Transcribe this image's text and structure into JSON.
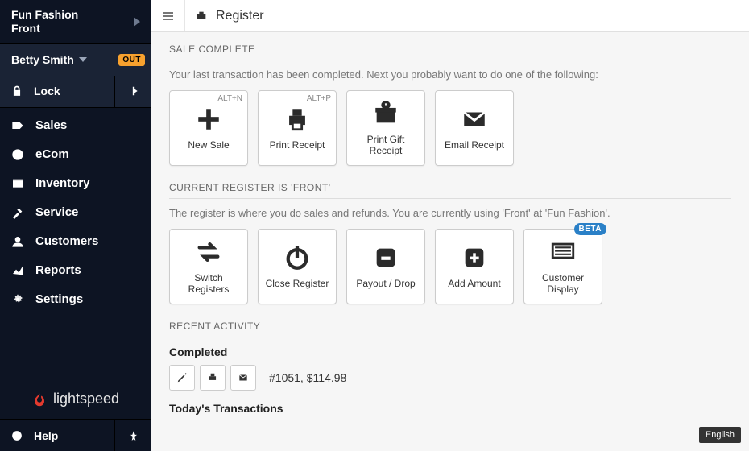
{
  "shop": {
    "name": "Fun Fashion\nFront"
  },
  "user": {
    "name": "Betty Smith",
    "badge": "OUT"
  },
  "lock_label": "Lock",
  "nav": [
    "Sales",
    "eCom",
    "Inventory",
    "Service",
    "Customers",
    "Reports",
    "Settings"
  ],
  "brand": "lightspeed",
  "help_label": "Help",
  "topbar": {
    "title": "Register"
  },
  "sale_complete": {
    "heading": "SALE COMPLETE",
    "subtext": "Your last transaction has been completed. Next you probably want to do one of the following:",
    "tiles": [
      {
        "label": "New Sale",
        "shortcut": "ALT+N"
      },
      {
        "label": "Print Receipt",
        "shortcut": "ALT+P"
      },
      {
        "label": "Print Gift Receipt",
        "shortcut": ""
      },
      {
        "label": "Email Receipt",
        "shortcut": ""
      }
    ]
  },
  "register": {
    "heading": "CURRENT REGISTER IS 'FRONT'",
    "subtext": "The register is where you do sales and refunds. You are currently using 'Front'  at 'Fun Fashion'.",
    "tiles": [
      {
        "label": "Switch Registers"
      },
      {
        "label": "Close Register"
      },
      {
        "label": "Payout / Drop"
      },
      {
        "label": "Add Amount"
      },
      {
        "label": "Customer Display",
        "badge": "BETA"
      }
    ]
  },
  "activity": {
    "heading": "RECENT ACTIVITY",
    "completed_label": "Completed",
    "last": "#1051, $114.98",
    "todays_label": "Today's Transactions"
  },
  "language": "English"
}
